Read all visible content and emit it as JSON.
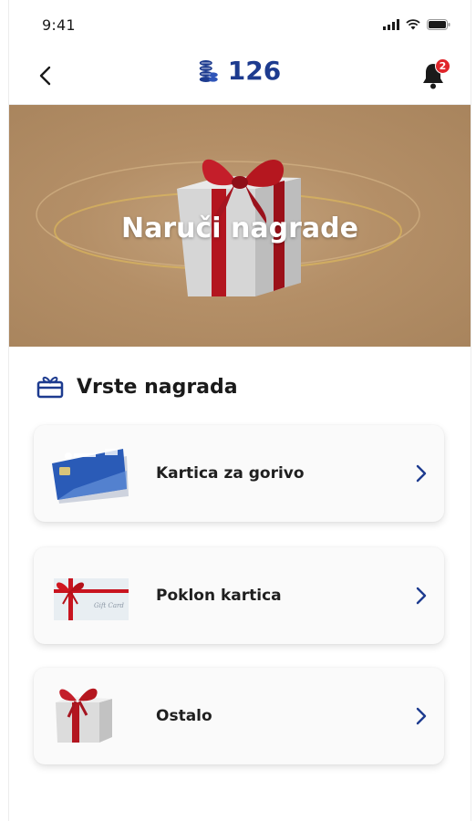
{
  "status_bar": {
    "time": "9:41"
  },
  "header": {
    "points": "126",
    "notifications_count": "2"
  },
  "banner": {
    "title": "Naruči nagrade"
  },
  "section": {
    "title": "Vrste nagrada"
  },
  "rewards": [
    {
      "label": "Kartica za gorivo",
      "icon": "fuel-card"
    },
    {
      "label": "Poklon kartica",
      "icon": "gift-card"
    },
    {
      "label": "Ostalo",
      "icon": "gift-box"
    }
  ],
  "colors": {
    "accent": "#1d3b8f",
    "badge": "#e0262b",
    "banner": "#b48f67"
  }
}
